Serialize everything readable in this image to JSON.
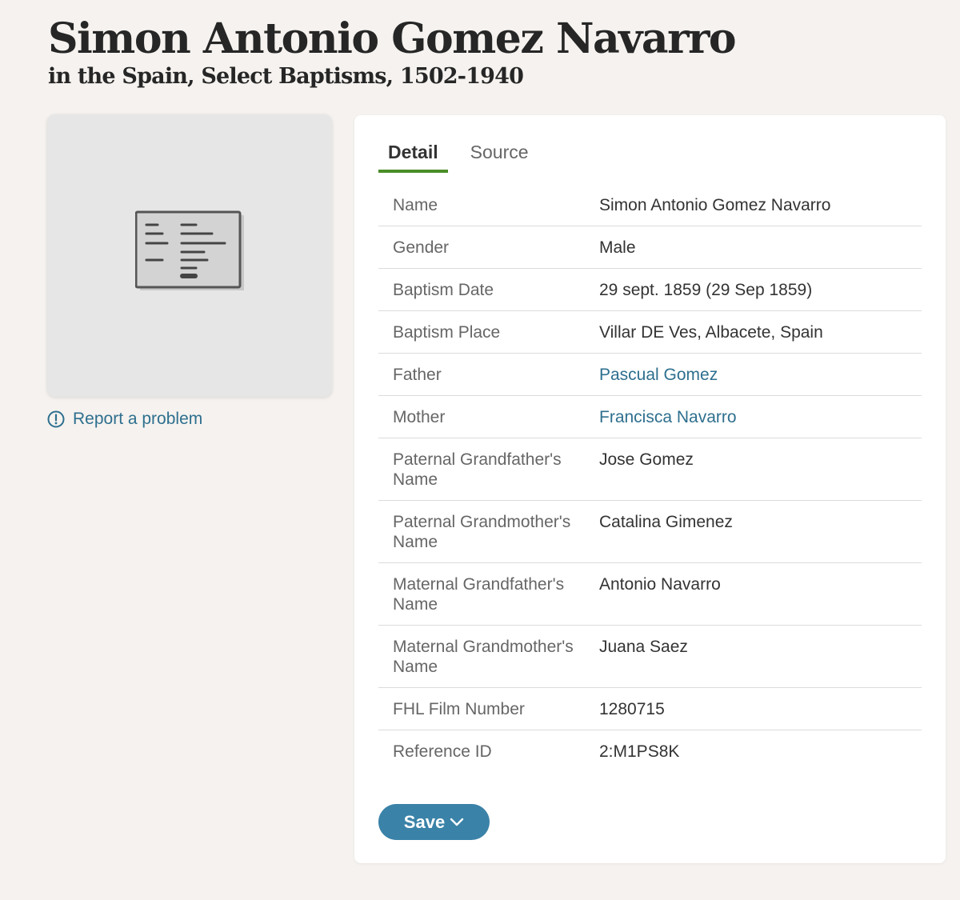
{
  "header": {
    "title": "Simon Antonio Gomez Navarro",
    "subtitle": "in the Spain, Select Baptisms, 1502-1940"
  },
  "sidebar": {
    "thumbnail_icon": "record-document-icon",
    "report_label": "Report a problem",
    "report_icon": "alert-circle-icon"
  },
  "tabs": [
    {
      "label": "Detail",
      "active": true
    },
    {
      "label": "Source",
      "active": false
    }
  ],
  "details": [
    {
      "label": "Name",
      "value": "Simon Antonio Gomez Navarro"
    },
    {
      "label": "Gender",
      "value": "Male"
    },
    {
      "label": "Baptism Date",
      "value": "29 sept. 1859 (29 Sep 1859)"
    },
    {
      "label": "Baptism Place",
      "value": "Villar DE Ves, Albacete, Spain"
    },
    {
      "label": "Father",
      "value": "Pascual Gomez",
      "link": true
    },
    {
      "label": "Mother",
      "value": "Francisca Navarro",
      "link": true
    },
    {
      "label": "Paternal Grandfather's Name",
      "value": "Jose Gomez"
    },
    {
      "label": "Paternal Grandmother's Name",
      "value": "Catalina Gimenez"
    },
    {
      "label": "Maternal Grandfather's Name",
      "value": "Antonio Navarro"
    },
    {
      "label": "Maternal Grandmother's Name",
      "value": "Juana Saez"
    },
    {
      "label": "FHL Film Number",
      "value": "1280715"
    },
    {
      "label": "Reference ID",
      "value": "2:M1PS8K"
    }
  ],
  "save_button": {
    "label": "Save",
    "icon": "chevron-down-icon"
  },
  "colors": {
    "background": "#f5f2ef",
    "link": "#2e6f8e",
    "tab_underline": "#4a8d27",
    "save_button": "#3a82a8"
  }
}
